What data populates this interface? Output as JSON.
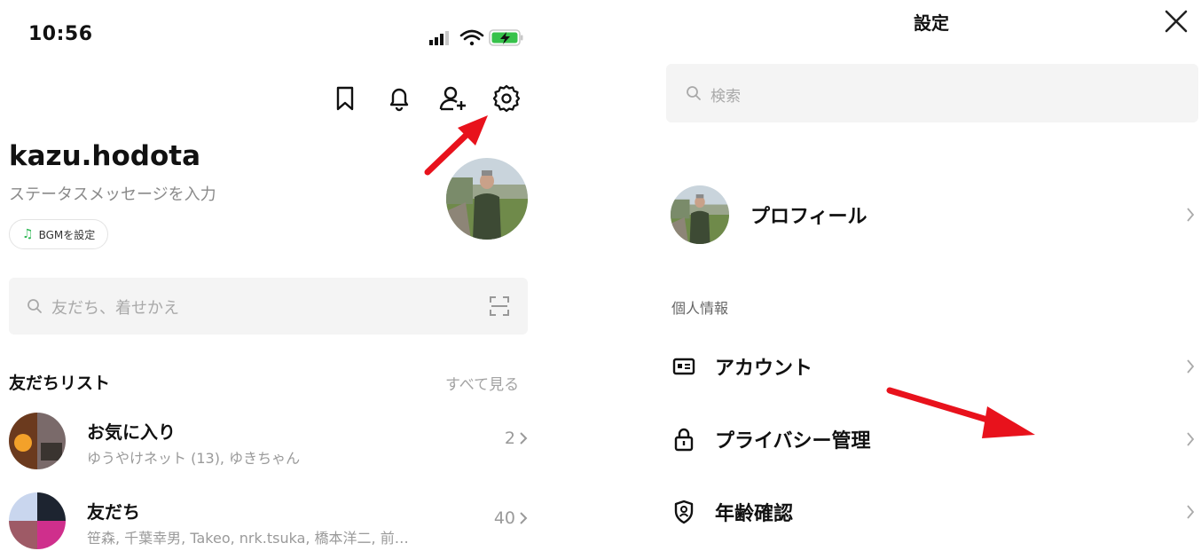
{
  "left": {
    "status_bar": {
      "time": "10:56"
    },
    "profile": {
      "username": "kazu.hodota",
      "status_message": "ステータスメッセージを入力",
      "bgm_label": "BGMを設定"
    },
    "search": {
      "placeholder": "友だち、着せかえ"
    },
    "friends_section": {
      "title": "友だちリスト",
      "see_all": "すべて見る",
      "rows": [
        {
          "name": "お気に入り",
          "members": "ゆうやけネット (13), ゆきちゃん",
          "count": "2"
        },
        {
          "name": "友だち",
          "members": "笹森, 千葉幸男, Takeo, nrk.tsuka, 橋本洋二, 前…",
          "count": "40"
        }
      ]
    }
  },
  "right": {
    "title": "設定",
    "search": {
      "placeholder": "検索"
    },
    "profile_item": "プロフィール",
    "group_label": "個人情報",
    "items": [
      {
        "label": "アカウント",
        "icon": "id-card-icon"
      },
      {
        "label": "プライバシー管理",
        "icon": "lock-icon"
      },
      {
        "label": "年齢確認",
        "icon": "age-shield-icon"
      }
    ]
  },
  "colors": {
    "annotation_arrow": "#e8121c",
    "bgm_note": "#2fb855"
  }
}
